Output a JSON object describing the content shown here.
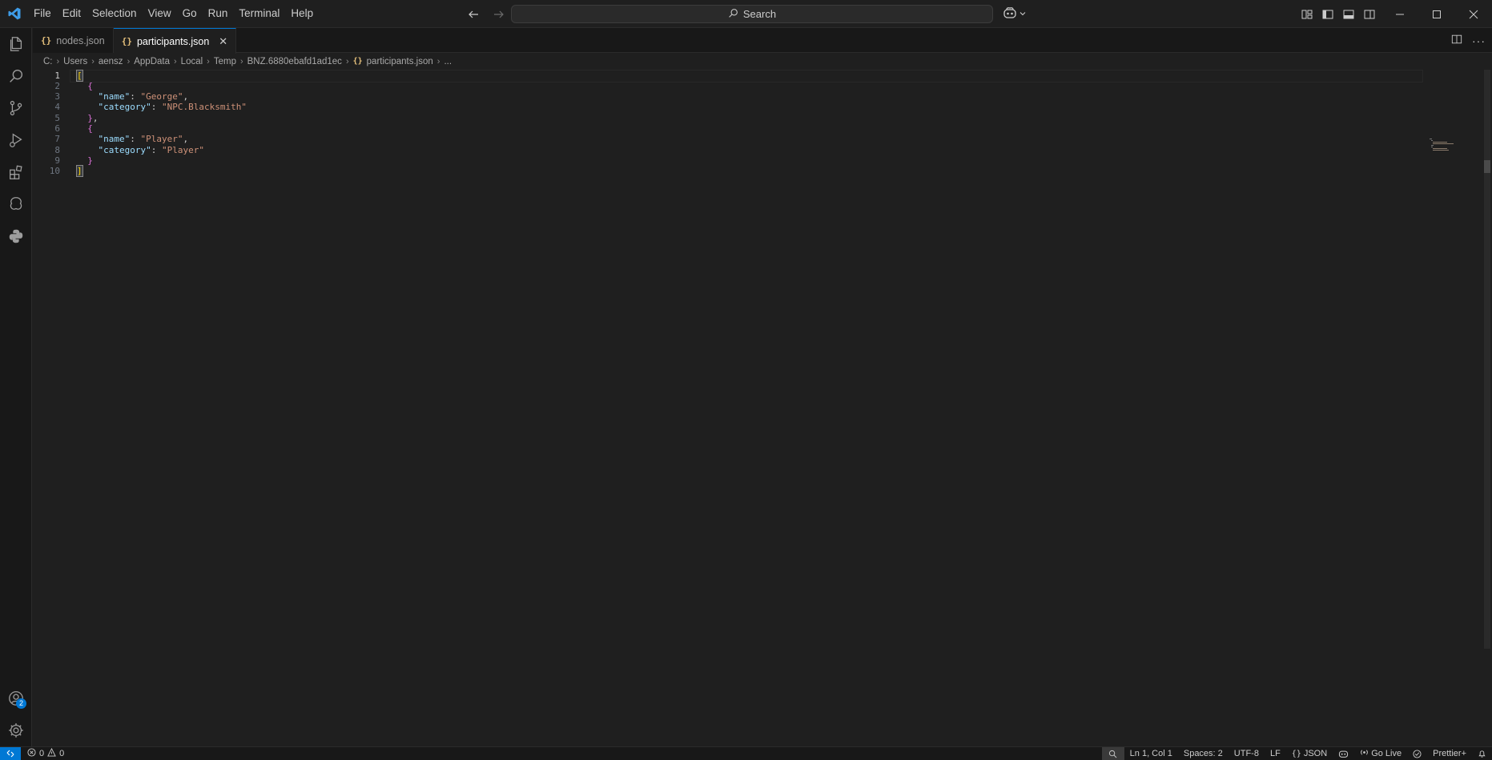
{
  "menu": [
    "File",
    "Edit",
    "Selection",
    "View",
    "Go",
    "Run",
    "Terminal",
    "Help"
  ],
  "search": {
    "label": "Search"
  },
  "tabs": [
    {
      "label": "nodes.json",
      "icon": "{}"
    },
    {
      "label": "participants.json",
      "icon": "{}"
    }
  ],
  "breadcrumb": {
    "parts": [
      "C:",
      "Users",
      "aensz",
      "AppData",
      "Local",
      "Temp",
      "BNZ.6880ebafd1ad1ec"
    ],
    "file": "participants.json",
    "more": "..."
  },
  "editor": {
    "line_numbers": [
      "1",
      "2",
      "3",
      "4",
      "5",
      "6",
      "7",
      "8",
      "9",
      "10"
    ],
    "lines": [
      {
        "indent": "",
        "tokens": [
          {
            "t": "[",
            "c": "tok-br1 bracket-match"
          }
        ]
      },
      {
        "indent": "  ",
        "tokens": [
          {
            "t": "{",
            "c": "tok-br2"
          }
        ]
      },
      {
        "indent": "    ",
        "tokens": [
          {
            "t": "\"name\"",
            "c": "tok-key"
          },
          {
            "t": ": ",
            "c": "tok-punc"
          },
          {
            "t": "\"George\"",
            "c": "tok-str"
          },
          {
            "t": ",",
            "c": "tok-punc"
          }
        ]
      },
      {
        "indent": "    ",
        "tokens": [
          {
            "t": "\"category\"",
            "c": "tok-key"
          },
          {
            "t": ": ",
            "c": "tok-punc"
          },
          {
            "t": "\"NPC.Blacksmith\"",
            "c": "tok-str"
          }
        ]
      },
      {
        "indent": "  ",
        "tokens": [
          {
            "t": "}",
            "c": "tok-br2"
          },
          {
            "t": ",",
            "c": "tok-punc"
          }
        ]
      },
      {
        "indent": "  ",
        "tokens": [
          {
            "t": "{",
            "c": "tok-br2"
          }
        ]
      },
      {
        "indent": "    ",
        "tokens": [
          {
            "t": "\"name\"",
            "c": "tok-key"
          },
          {
            "t": ": ",
            "c": "tok-punc"
          },
          {
            "t": "\"Player\"",
            "c": "tok-str"
          },
          {
            "t": ",",
            "c": "tok-punc"
          }
        ]
      },
      {
        "indent": "    ",
        "tokens": [
          {
            "t": "\"category\"",
            "c": "tok-key"
          },
          {
            "t": ": ",
            "c": "tok-punc"
          },
          {
            "t": "\"Player\"",
            "c": "tok-str"
          }
        ]
      },
      {
        "indent": "  ",
        "tokens": [
          {
            "t": "}",
            "c": "tok-br2"
          }
        ]
      },
      {
        "indent": "",
        "tokens": [
          {
            "t": "]",
            "c": "tok-br1 bracket-match"
          }
        ]
      }
    ]
  },
  "activity": {
    "account_badge": "2"
  },
  "status": {
    "errors": "0",
    "warnings": "0",
    "position": "Ln 1, Col 1",
    "spaces": "Spaces: 2",
    "encoding": "UTF-8",
    "eol": "LF",
    "language": "JSON",
    "go_live": "Go Live",
    "prettier": "Prettier+"
  },
  "colors": {
    "accent": "#0078d4",
    "editor_bg": "#1f1f1f",
    "key": "#9cdcfe",
    "string": "#ce9178"
  }
}
